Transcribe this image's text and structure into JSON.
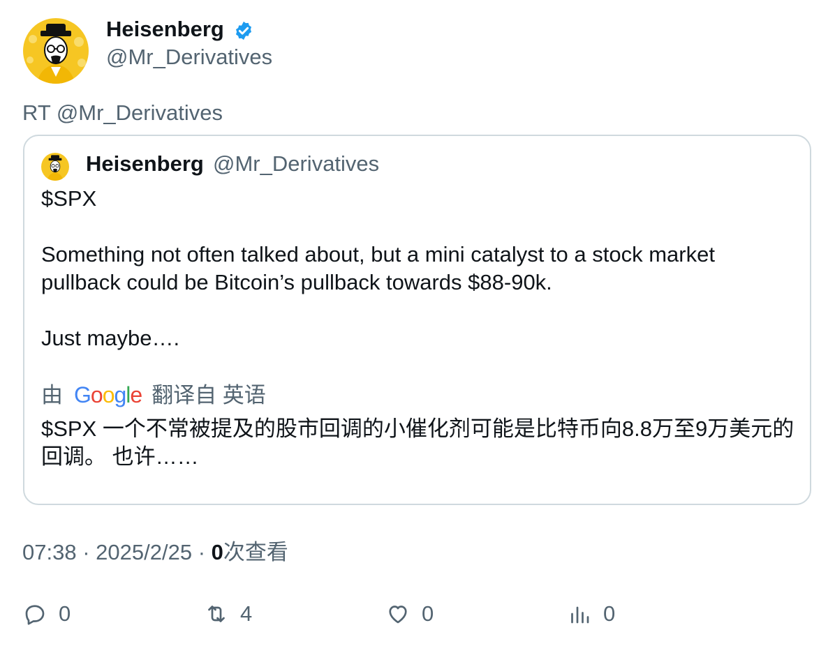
{
  "author": {
    "name": "Heisenberg",
    "handle": "@Mr_Derivatives",
    "verified": true
  },
  "retweet_line": "RT @Mr_Derivatives",
  "quoted": {
    "name": "Heisenberg",
    "handle": "@Mr_Derivatives",
    "text_line1": "$SPX",
    "text_para2": "Something not often talked about, but a mini catalyst to a stock market pullback could be Bitcoin’s pullback towards $88-90k.",
    "text_para3": "Just maybe….",
    "translate_prefix": "由",
    "translate_provider": "Google",
    "translate_suffix": "翻译自 英语",
    "translated_text": "$SPX 一个不常被提及的股市回调的小催化剂可能是比特币向8.8万至9万美元的回调。 也许……"
  },
  "meta": {
    "time": "07:38",
    "sep1": "·",
    "date": "2025/2/25",
    "sep2": "·",
    "views_count": "0",
    "views_label": "次查看"
  },
  "actions": {
    "reply_count": "0",
    "retweet_count": "4",
    "like_count": "0",
    "views_count": "0"
  },
  "colors": {
    "verified_blue": "#1d9bf0",
    "muted": "#536471",
    "border": "#cfd9de",
    "avatar_yellow": "#f6c623"
  }
}
